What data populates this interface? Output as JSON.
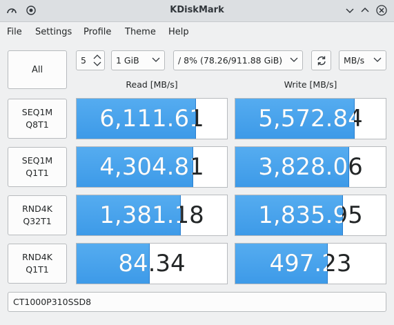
{
  "window": {
    "title": "KDiskMark"
  },
  "menu": [
    "File",
    "Settings",
    "Profile",
    "Theme",
    "Help"
  ],
  "controls": {
    "all_label": "All",
    "runs": "5",
    "size": "1 GiB",
    "target": "/ 8% (78.26/911.88 GiB)",
    "unit": "MB/s"
  },
  "headers": {
    "read": "Read [MB/s]",
    "write": "Write [MB/s]"
  },
  "tests": [
    {
      "name": "SEQ1M",
      "params": "Q8T1",
      "read": "6,111.61",
      "write": "5,572.84",
      "read_fill": 0.79,
      "write_fill": 0.79
    },
    {
      "name": "SEQ1M",
      "params": "Q1T1",
      "read": "4,304.81",
      "write": "3,828.06",
      "read_fill": 0.77,
      "write_fill": 0.75
    },
    {
      "name": "RND4K",
      "params": "Q32T1",
      "read": "1,381.18",
      "write": "1,835.95",
      "read_fill": 0.69,
      "write_fill": 0.71
    },
    {
      "name": "RND4K",
      "params": "Q1T1",
      "read": "84.34",
      "write": "497.23",
      "read_fill": 0.48,
      "write_fill": 0.61
    }
  ],
  "device": "CT1000P310SSD8",
  "colors": {
    "accent": "#3d9ae8",
    "bar_border": "#2a7fcf"
  }
}
